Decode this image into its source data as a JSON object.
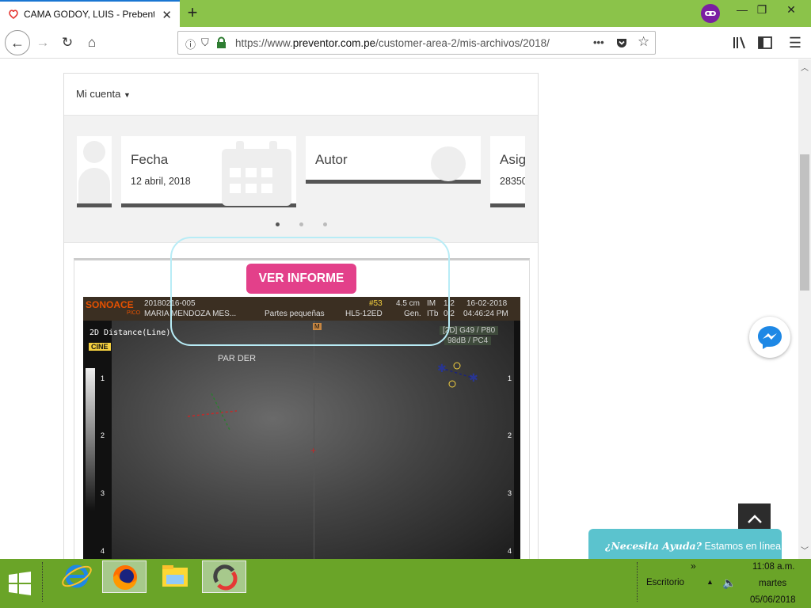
{
  "browser": {
    "tab_title": "CAMA GODOY, LUIS - Prebentor",
    "url_prefix": "https://www.",
    "url_domain": "preventor.com.pe",
    "url_path": "/customer-area-2/mis-archivos/2018/"
  },
  "page": {
    "account_menu": "Mi cuenta",
    "slides": [
      {
        "label": "Fecha",
        "value": "12 abril, 2018"
      },
      {
        "label": "Autor",
        "value": ""
      },
      {
        "label": "Asig",
        "value": "28350"
      }
    ],
    "report_button": "VER INFORME",
    "ultrasound": {
      "brand": "SONOACE",
      "brand_sub": "PICO",
      "study_id": "20180216-005",
      "patient": "MARIA MENDOZA MES...",
      "preset": "Partes pequeñas",
      "frame": "#53",
      "probe": "HL5-12ED",
      "depth": "4.5 cm",
      "mode": "Gen.",
      "im": "IM",
      "itb": "ITb",
      "im_val": "1.2",
      "itb_val": "0.2",
      "date": "16-02-2018",
      "time": "04:46:24 PM",
      "measurement": "2D Distance(Line)",
      "cine": "CINE",
      "gain": "[2D] G49 / P80",
      "dr": "98dB / PC4",
      "label": "PAR DER",
      "m_marker": "M",
      "depth_ticks": [
        "1",
        "2",
        "3",
        "4"
      ]
    },
    "help_bold": "¿Necesita Ayuda?",
    "help_text": " Estamos en línea"
  },
  "taskbar": {
    "desktop_label": "Escritorio",
    "time": "11:08 a.m.",
    "day": "martes",
    "date": "05/06/2018"
  },
  "colors": {
    "titlebar": "#8bc34a",
    "taskbar": "#6aa428",
    "button": "#e3408a",
    "help": "#5bc3ce"
  }
}
